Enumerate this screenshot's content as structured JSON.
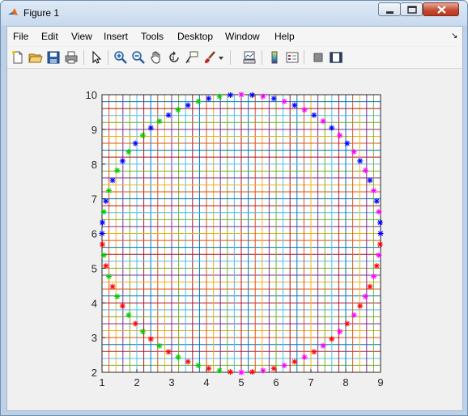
{
  "window": {
    "title": "Figure 1"
  },
  "menu": {
    "items": [
      "File",
      "Edit",
      "View",
      "Insert",
      "Tools",
      "Desktop",
      "Window",
      "Help"
    ]
  },
  "toolbar": {
    "icons": [
      "new-figure-icon",
      "open-file-icon",
      "save-icon",
      "print-icon",
      "select-arrow-icon",
      "zoom-in-icon",
      "zoom-out-icon",
      "pan-icon",
      "rotate-3d-icon",
      "data-cursor-icon",
      "brush-icon",
      "brush-dropdown-icon",
      "link-plot-icon",
      "colorbar-icon",
      "legend-icon",
      "hide-plot-tools-icon",
      "show-plot-tools-icon"
    ]
  },
  "chart_data": {
    "type": "scatter",
    "xlim": [
      1,
      9
    ],
    "ylim": [
      2,
      10
    ],
    "xticks": [
      1,
      2,
      3,
      4,
      5,
      6,
      7,
      8,
      9
    ],
    "yticks": [
      2,
      3,
      4,
      5,
      6,
      7,
      8,
      9,
      10
    ],
    "grid": "colored lines at x = 1..9 and y = 2..10",
    "circle": {
      "center": [
        5,
        6
      ],
      "radius": 4
    },
    "marker": "*",
    "series": [
      {
        "color": "#0000ff",
        "angles_deg": [
          0,
          90,
          180,
          270
        ]
      },
      {
        "color": "#ff00ff",
        "angles_deg": [
          0,
          90,
          180,
          270
        ]
      },
      {
        "color": "#ff0000",
        "angles_deg": [
          180,
          360
        ]
      },
      {
        "color": "#00cc00",
        "angles_deg": [
          90,
          270
        ]
      }
    ],
    "points_per_quadrant": 20
  }
}
